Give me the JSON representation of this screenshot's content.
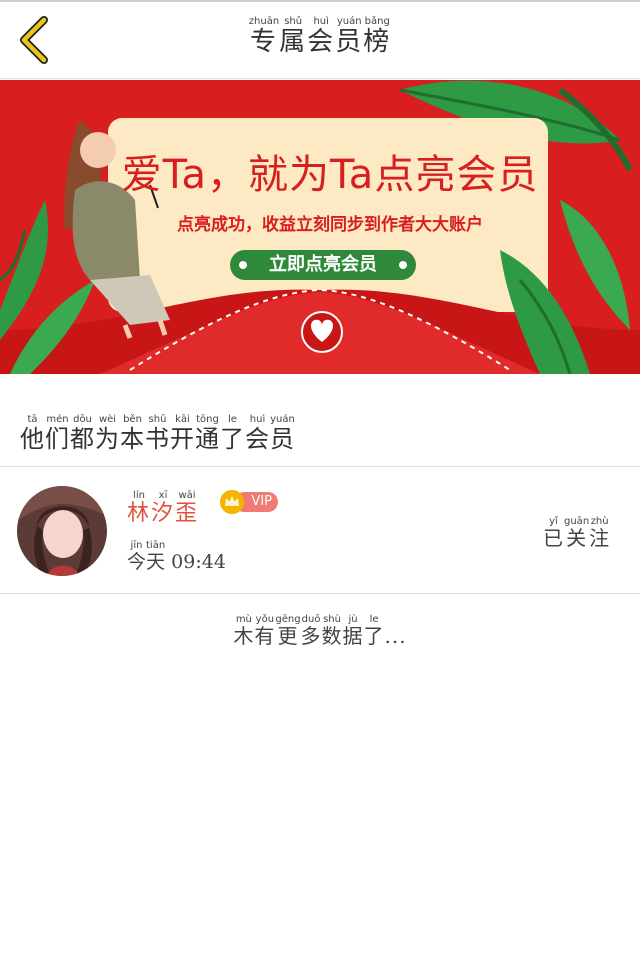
{
  "header": {
    "title": "专属会员榜",
    "title_pinyin": "zhuān shǔ huì yuán bǎng",
    "title_chars": [
      "专",
      "属",
      "会",
      "员",
      "榜"
    ],
    "title_py": [
      "zhuān",
      "shǔ",
      "huì",
      "yuán",
      "bǎng"
    ]
  },
  "banner": {
    "headline": "爱Ta，就为Ta点亮会员",
    "subtitle": "点亮成功，收益立刻同步到作者大大账户",
    "button_label": "立即点亮会员"
  },
  "section": {
    "chars": [
      "他",
      "们",
      "都",
      "为",
      "本",
      "书",
      "开",
      "通",
      "了",
      "会",
      "员"
    ],
    "py": [
      "tā",
      "mén",
      "dōu",
      "wèi",
      "běn",
      "shū",
      "kāi",
      "tōng",
      "le",
      "huì",
      "yuán"
    ]
  },
  "member": {
    "name_chars": [
      "林",
      "汐",
      "歪"
    ],
    "name_py": [
      "lín",
      "xī",
      "wāi"
    ],
    "vip_label": "VIP",
    "time_chars": [
      "今",
      "天"
    ],
    "time_py": [
      "jīn",
      "tiān"
    ],
    "time_value": " 09:44",
    "follow_chars": [
      "已",
      "关",
      "注"
    ],
    "follow_py": [
      "yǐ",
      "guān",
      "zhù"
    ]
  },
  "footer": {
    "chars": [
      "木",
      "有",
      "更",
      "多",
      "数",
      "据",
      "了"
    ],
    "py": [
      "mù",
      "yǒu",
      "gēng",
      "duō",
      "shù",
      "jù",
      "le"
    ],
    "suffix": "..."
  },
  "colors": {
    "banner_red": "#d81e1e",
    "card_cream": "#fde9c4",
    "button_green": "#2e8a3a",
    "name_orange": "#e0533b",
    "back_yellow": "#e8c51a"
  },
  "icons": {
    "back": "chevron-left-icon",
    "crown": "crown-icon",
    "heart_seal": "heart-seal-icon"
  }
}
